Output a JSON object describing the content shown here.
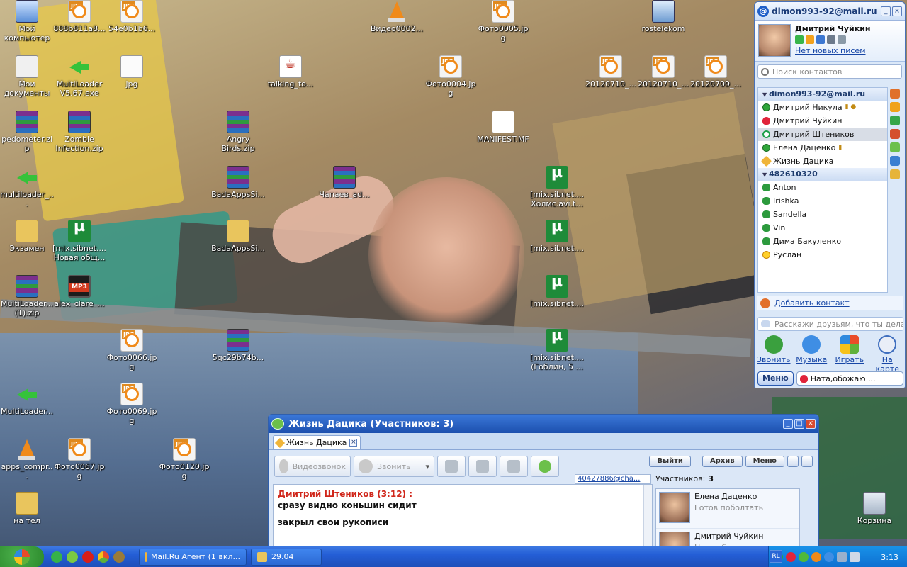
{
  "desktop": {
    "icons": [
      {
        "label": "Мой компьютер",
        "type": "comp"
      },
      {
        "label": "888b811a8...",
        "type": "jpg"
      },
      {
        "label": "54e0b1b6...",
        "type": "jpg"
      },
      {
        "label": "Видео0002...",
        "type": "vlc"
      },
      {
        "label": "Фото0005.jpg",
        "type": "jpg"
      },
      {
        "label": "rostelekom",
        "type": "net"
      },
      {
        "label": "Мои документы",
        "type": "docs"
      },
      {
        "label": "MultiLoader V5.67.exe",
        "type": "arrow"
      },
      {
        "label": "jpg",
        "type": "file"
      },
      {
        "label": "talking_to...",
        "type": "java"
      },
      {
        "label": "Фото0004.jpg",
        "type": "jpg"
      },
      {
        "label": "20120710_...",
        "type": "jpg"
      },
      {
        "label": "20120710_...",
        "type": "jpg"
      },
      {
        "label": "20120709_...",
        "type": "jpg"
      },
      {
        "label": "pedometer.zip",
        "type": "zip"
      },
      {
        "label": "Zombie Infection.zip",
        "type": "zip"
      },
      {
        "label": "Angry Birds.zip",
        "type": "zip"
      },
      {
        "label": "MANIFEST.MF",
        "type": "mf"
      },
      {
        "label": "multiloader_...",
        "type": "arrow"
      },
      {
        "label": "BadaAppsSi...",
        "type": "zip"
      },
      {
        "label": "Чапаев_ad...",
        "type": "zip"
      },
      {
        "label": "[mix.sibnet.... Холмс.avi.t...",
        "type": "torrent"
      },
      {
        "label": "Экзамен",
        "type": "folder"
      },
      {
        "label": "[mix.sibnet.... Новая общ...",
        "type": "torrent"
      },
      {
        "label": "BadaAppsSi...",
        "type": "folder"
      },
      {
        "label": "[mix.sibnet....",
        "type": "torrent"
      },
      {
        "label": "MultiLoader... (1).zip",
        "type": "zip"
      },
      {
        "label": "alex_clare_...",
        "type": "mp3"
      },
      {
        "label": "[mix.sibnet....",
        "type": "torrent"
      },
      {
        "label": "Фото0066.jpg",
        "type": "jpg"
      },
      {
        "label": "5qc29b74b...",
        "type": "zip"
      },
      {
        "label": "[mix.sibnet.... (Гоблин, 5 ...",
        "type": "torrent"
      },
      {
        "label": "MultiLoader...",
        "type": "arrow"
      },
      {
        "label": "Фото0069.jpg",
        "type": "jpg"
      },
      {
        "label": "apps_compr...",
        "type": "vlc"
      },
      {
        "label": "Фото0067.jpg",
        "type": "jpg"
      },
      {
        "label": "Фото0120.jpg",
        "type": "jpg"
      },
      {
        "label": "на тел",
        "type": "folder"
      },
      {
        "label": "Корзина",
        "type": "trash"
      }
    ]
  },
  "agent": {
    "title": "dimon993-92@mail.ru",
    "profile_name": "Дмитрий Чуйкин",
    "mail_status": "Нет новых писем",
    "search_placeholder": "Поиск контактов",
    "groups": [
      {
        "name": "dimon993-92@mail.ru",
        "contacts": [
          {
            "name": "Дмитрий Никула",
            "status": "online",
            "extra": "▮ ●"
          },
          {
            "name": "Дмитрий Чуйкин",
            "status": "heart",
            "extra": ""
          },
          {
            "name": "Дмитрий Штеников",
            "status": "at",
            "extra": "",
            "selected": true
          },
          {
            "name": "Елена Даценко",
            "status": "online",
            "extra": "▮"
          },
          {
            "name": "Жизнь Дацика",
            "status": "pen",
            "extra": ""
          }
        ]
      },
      {
        "name": "482610320",
        "contacts": [
          {
            "name": "Anton",
            "status": "clover"
          },
          {
            "name": "Irishka",
            "status": "clover"
          },
          {
            "name": "Sandella",
            "status": "clover"
          },
          {
            "name": "Vin",
            "status": "clover"
          },
          {
            "name": "Дима Бакуленко",
            "status": "clover"
          },
          {
            "name": "Руслан",
            "status": "smile"
          }
        ]
      }
    ],
    "add_contact": "Добавить контакт",
    "status_placeholder": "Расскажи друзьям, что ты дела...",
    "actions": [
      "Звонить",
      "Музыка",
      "Играть",
      "На карте"
    ],
    "menu_label": "Меню",
    "status_text": "Ната,обожаю ..."
  },
  "chat": {
    "title": "Жизнь Дацика (Участников: 3)",
    "tab_label": "Жизнь Дацика",
    "video_call": "Видеозвонок",
    "call": "Звонить",
    "exit": "Выйти",
    "archive": "Архив",
    "menu": "Меню",
    "conf_id": "40427886@cha...",
    "participants_label": "Участников:",
    "participants_count": "3",
    "messages": [
      {
        "author": "Дмитрий Штеников (3:12) :",
        "lines": [
          "сразу видно коньшин сидит",
          "закрыл свои рукописи"
        ]
      }
    ],
    "participants": [
      {
        "name": "Елена Даценко",
        "status": "Готов поболтать"
      },
      {
        "name": "Дмитрий Чуйкин",
        "status": "Ната,обожаю тебя,любимая"
      }
    ]
  },
  "taskbar": {
    "tasks": [
      {
        "label": "Mail.Ru Агент (1 вкл...",
        "icon": "pen"
      },
      {
        "label": "29.04",
        "icon": "folder"
      }
    ],
    "lang": "RL",
    "clock": "3:13"
  }
}
